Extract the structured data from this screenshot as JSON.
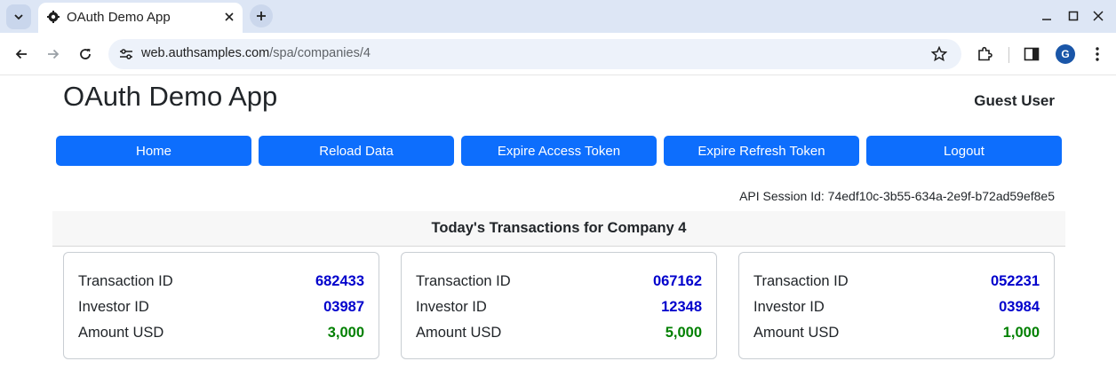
{
  "browser": {
    "tab_title": "OAuth Demo App",
    "url_host": "web.authsamples.com",
    "url_path": "/spa/companies/4",
    "avatar_letter": "G"
  },
  "app": {
    "title": "OAuth Demo App",
    "user": "Guest User",
    "buttons": {
      "home": "Home",
      "reload": "Reload Data",
      "expire_access": "Expire Access Token",
      "expire_refresh": "Expire Refresh Token",
      "logout": "Logout"
    },
    "session_id": "API Session Id: 74edf10c-3b55-634a-2e9f-b72ad59ef8e5",
    "section_title": "Today's Transactions for Company 4",
    "labels": {
      "transaction_id": "Transaction ID",
      "investor_id": "Investor ID",
      "amount": "Amount USD"
    },
    "transactions": [
      {
        "transaction_id": "682433",
        "investor_id": "03987",
        "amount": "3,000"
      },
      {
        "transaction_id": "067162",
        "investor_id": "12348",
        "amount": "5,000"
      },
      {
        "transaction_id": "052231",
        "investor_id": "03984",
        "amount": "1,000"
      }
    ]
  },
  "colors": {
    "button": "#0d6efd",
    "id_value": "#0000cc",
    "amount_value": "#008000"
  }
}
